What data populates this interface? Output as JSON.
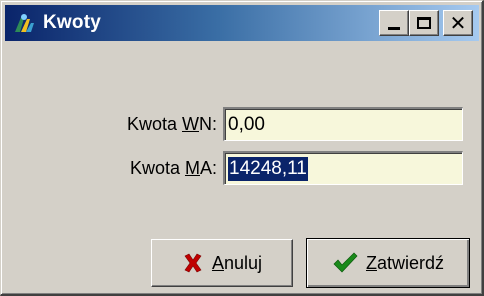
{
  "window": {
    "title": "Kwoty",
    "title_icon": "app-icon",
    "buttons": {
      "minimize_icon": "minimize-icon",
      "maximize_icon": "maximize-icon",
      "close_glyph": "✕"
    }
  },
  "form": {
    "wn": {
      "label_prefix": "Kwota ",
      "label_accel": "W",
      "label_rest": "N:",
      "value": "0,00"
    },
    "ma": {
      "label_prefix": "Kwota ",
      "label_accel": "M",
      "label_rest": "A:",
      "value": "14248,11",
      "selected": true
    }
  },
  "actions": {
    "cancel": {
      "accel": "A",
      "rest": "nuluj",
      "icon": "x-icon",
      "icon_color": "#c00000"
    },
    "confirm": {
      "accel": "Z",
      "rest": "atwierdź",
      "icon": "checkmark-icon",
      "icon_color": "#1a8a1a"
    }
  },
  "colors": {
    "title_start": "#0a246a",
    "title_end": "#a6caf0",
    "field_bg": "#f7f7db",
    "selection": "#0a246a"
  }
}
